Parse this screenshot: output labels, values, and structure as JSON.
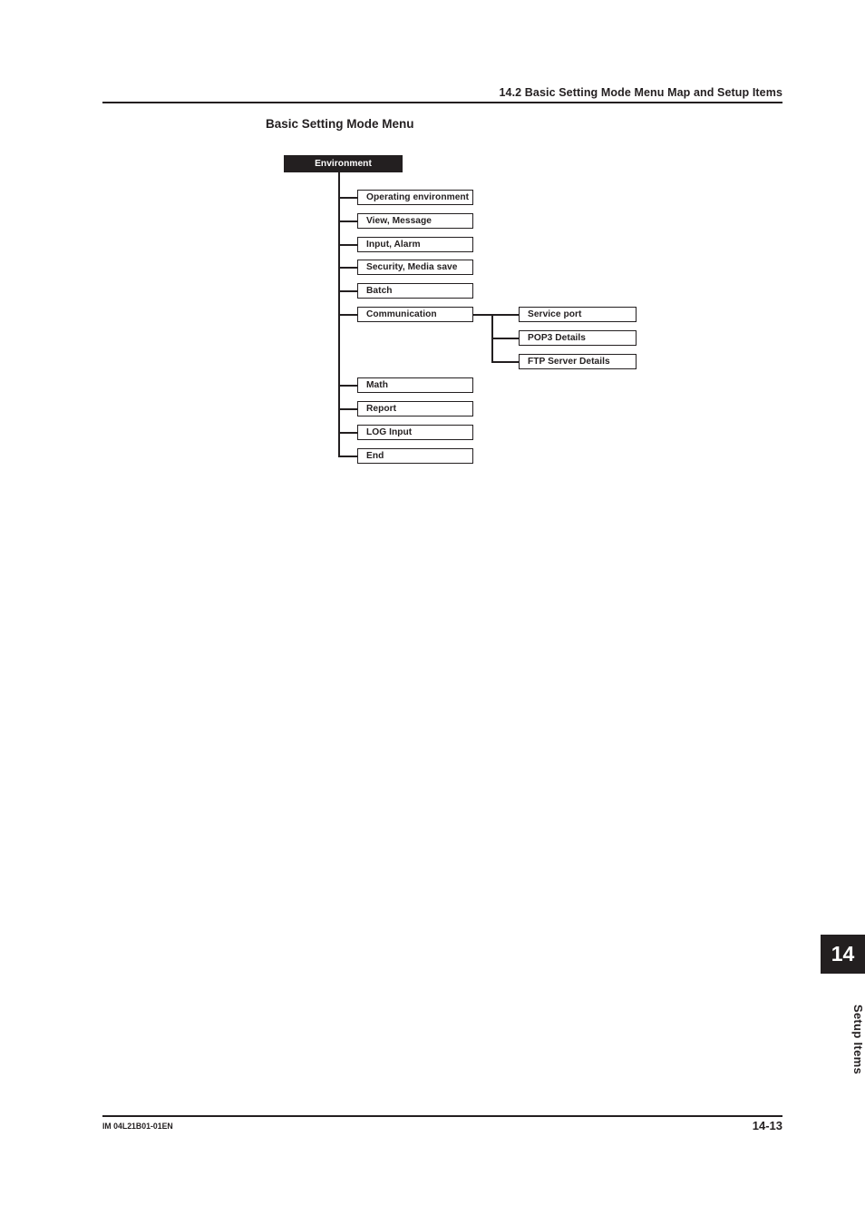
{
  "header": {
    "title": "14.2  Basic Setting Mode Menu Map and Setup Items"
  },
  "section": {
    "heading": "Basic Setting Mode Menu"
  },
  "diagram": {
    "root": {
      "label": "Environment"
    },
    "level1": [
      {
        "label": "Operating environment"
      },
      {
        "label": "View, Message"
      },
      {
        "label": "Input, Alarm"
      },
      {
        "label": "Security, Media save"
      },
      {
        "label": "Batch"
      },
      {
        "label": "Communication"
      },
      {
        "label": "Math"
      },
      {
        "label": "Report"
      },
      {
        "label": "LOG Input"
      },
      {
        "label": "End"
      }
    ],
    "level2": [
      {
        "label": "Service port"
      },
      {
        "label": "POP3 Details"
      },
      {
        "label": "FTP Server Details"
      }
    ]
  },
  "margin": {
    "chapter_number": "14",
    "chapter_label": "Setup Items"
  },
  "footer": {
    "document_code": "IM 04L21B01-01EN",
    "page_number": "14-13"
  },
  "colors": {
    "ink": "#231f20",
    "paper": "#ffffff"
  }
}
